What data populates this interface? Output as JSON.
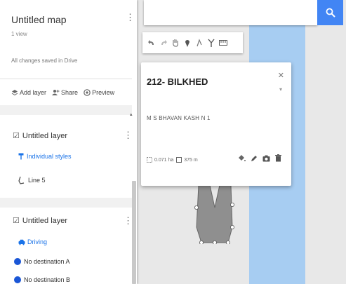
{
  "panel": {
    "map_title": "Untitled map",
    "views": "1 view",
    "saved_status": "All changes saved in Drive",
    "actions": {
      "add_layer": "Add layer",
      "share": "Share",
      "preview": "Preview"
    },
    "layers": [
      {
        "title": "Untitled layer",
        "style": "Individual styles",
        "items": [
          "Line 5"
        ]
      },
      {
        "title": "Untitled layer",
        "style": "Driving",
        "items": [
          "No destination A",
          "No destination B"
        ]
      }
    ]
  },
  "card": {
    "title": "212- BILKHED",
    "description": "M S BHAVAN KASH N 1",
    "area": "0.071 ha",
    "perimeter": "375 m"
  },
  "colors": {
    "accent": "#4285f4",
    "water": "#a7cdf2",
    "map_bg": "#e8e8e8",
    "link": "#1a73e8"
  },
  "icons": [
    "search-icon",
    "undo-icon",
    "redo-icon",
    "hand-icon",
    "marker-icon",
    "draw-line-icon",
    "route-icon",
    "ruler-icon",
    "paint-bucket-icon",
    "pencil-icon",
    "camera-icon",
    "trash-icon"
  ]
}
